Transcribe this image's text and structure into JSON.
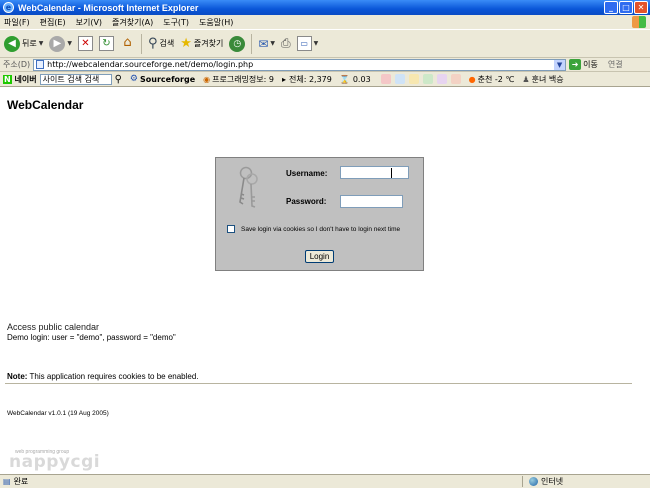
{
  "window": {
    "title": "WebCalendar - Microsoft Internet Explorer"
  },
  "menu": {
    "items": [
      "파일(F)",
      "편집(E)",
      "보기(V)",
      "즐겨찾기(A)",
      "도구(T)",
      "도움말(H)"
    ]
  },
  "toolbar": {
    "back_label": "뒤로",
    "search_label": "검색",
    "favorites_label": "즐겨찾기"
  },
  "address": {
    "label": "주소(D)",
    "url": "http://webcalendar.sourceforge.net/demo/login.php",
    "go_label": "이동",
    "links_label": "연결"
  },
  "linksbar": {
    "naver_label": "네이버",
    "search_placeholder": "사이트 검색 검색",
    "sourceforge_label": "Sourceforge",
    "program_info": "프로그래밍정보: 9",
    "total": "전체: 2,379",
    "rate": "0.03",
    "weather": "춘천 -2 ℃",
    "extra": "훈녀 백승"
  },
  "page": {
    "title": "WebCalendar",
    "login": {
      "username_label": "Username:",
      "username_value": "",
      "password_label": "Password:",
      "password_value": "",
      "remember_label": "Save login via cookies so I don't have to login next time",
      "remember_checked": false,
      "button_label": "Login"
    },
    "public_link": "Access public calendar",
    "demo_login": "Demo login: user = \"demo\", password = \"demo\"",
    "note_bold": "Note:",
    "note_text": " This application requires cookies to be enabled.",
    "version": "WebCalendar v1.0.1 (19 Aug 2005)",
    "brand_tag": "web programming group",
    "brand_name": "nappycgi"
  },
  "status": {
    "text": "완료",
    "zone": "인터넷"
  }
}
